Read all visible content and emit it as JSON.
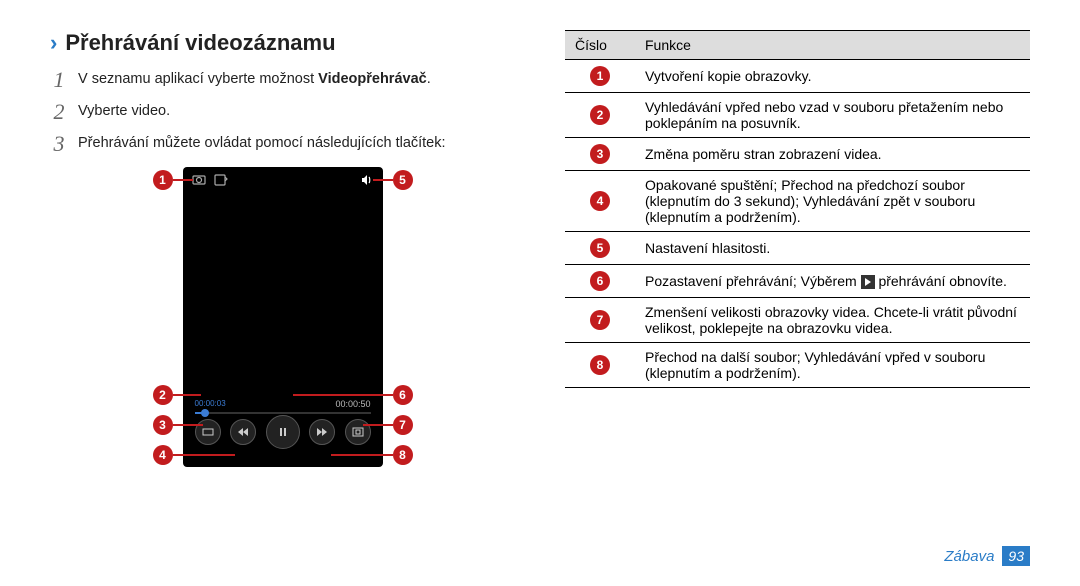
{
  "heading": "Přehrávání videozáznamu",
  "steps": [
    {
      "num": "1",
      "prefix": "V seznamu aplikací vyberte možnost ",
      "bold": "Videopřehrávač",
      "suffix": "."
    },
    {
      "num": "2",
      "prefix": "Vyberte video.",
      "bold": "",
      "suffix": ""
    },
    {
      "num": "3",
      "prefix": "Přehrávání můžete ovládat pomocí následujících tlačítek:",
      "bold": "",
      "suffix": ""
    }
  ],
  "timebar": {
    "current": "00:00:03",
    "total": "00:00:50"
  },
  "table": {
    "headers": {
      "num": "Číslo",
      "func": "Funkce"
    },
    "rows": [
      {
        "n": "1",
        "text": "Vytvoření kopie obrazovky."
      },
      {
        "n": "2",
        "text": "Vyhledávání vpřed nebo vzad v souboru přetažením nebo poklepáním na posuvník."
      },
      {
        "n": "3",
        "text": "Změna poměru stran zobrazení videa."
      },
      {
        "n": "4",
        "text": "Opakované spuštění; Přechod na předchozí soubor (klepnutím do 3 sekund); Vyhledávání zpět v souboru (klepnutím a podržením)."
      },
      {
        "n": "5",
        "text": "Nastavení hlasitosti."
      },
      {
        "n": "6",
        "text_a": "Pozastavení přehrávání; Výběrem ",
        "text_b": " přehrávání obnovíte.",
        "has_icon": "yes"
      },
      {
        "n": "7",
        "text": "Zmenšení velikosti obrazovky videa. Chcete-li vrátit původní velikost, poklepejte na obrazovku videa."
      },
      {
        "n": "8",
        "text": "Přechod na další soubor; Vyhledávání vpřed v souboru (klepnutím a podržením)."
      }
    ]
  },
  "callouts": {
    "c1": "1",
    "c2": "2",
    "c3": "3",
    "c4": "4",
    "c5": "5",
    "c6": "6",
    "c7": "7",
    "c8": "8"
  },
  "footer": {
    "category": "Zábava",
    "page": "93"
  }
}
